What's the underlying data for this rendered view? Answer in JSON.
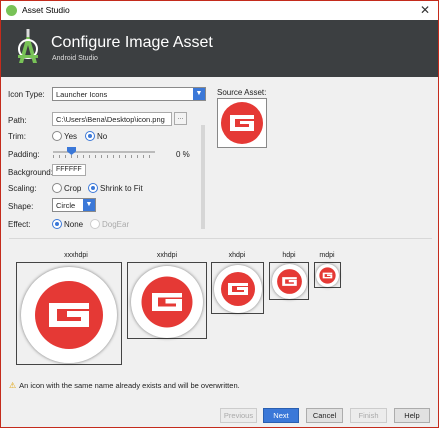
{
  "window": {
    "title": "Asset Studio",
    "close_glyph": "✕"
  },
  "header": {
    "title": "Configure Image Asset",
    "subtitle": "Android Studio"
  },
  "form": {
    "icon_type_label": "Icon Type:",
    "icon_type_value": "Launcher Icons",
    "path_label": "Path:",
    "path_value": "C:\\Users\\Bena\\Desktop\\icon.png",
    "browse_glyph": "...",
    "trim_label": "Trim:",
    "trim_yes": "Yes",
    "trim_no": "No",
    "trim_selected": "No",
    "padding_label": "Padding:",
    "padding_value": "0 %",
    "padding_percent": 0,
    "background_label": "Background:",
    "background_value": "FFFFFF",
    "scaling_label": "Scaling:",
    "scaling_crop": "Crop",
    "scaling_shrink": "Shrink to Fit",
    "scaling_selected": "Shrink to Fit",
    "shape_label": "Shape:",
    "shape_value": "Circle",
    "effect_label": "Effect:",
    "effect_none": "None",
    "effect_dogear": "DogEar",
    "effect_selected": "None"
  },
  "source": {
    "label": "Source Asset:"
  },
  "previews": [
    {
      "density": "xxxhdpi"
    },
    {
      "density": "xxhdpi"
    },
    {
      "density": "xhdpi"
    },
    {
      "density": "hdpi"
    },
    {
      "density": "mdpi"
    }
  ],
  "warning": {
    "text": "An icon with the same name already exists and will be overwritten."
  },
  "buttons": {
    "previous": "Previous",
    "next": "Next",
    "cancel": "Cancel",
    "finish": "Finish",
    "help": "Help"
  },
  "colors": {
    "accent": "#3b78d8",
    "header_bg": "#3c3f41",
    "logo_red": "#e53935",
    "android_green": "#78c257"
  }
}
